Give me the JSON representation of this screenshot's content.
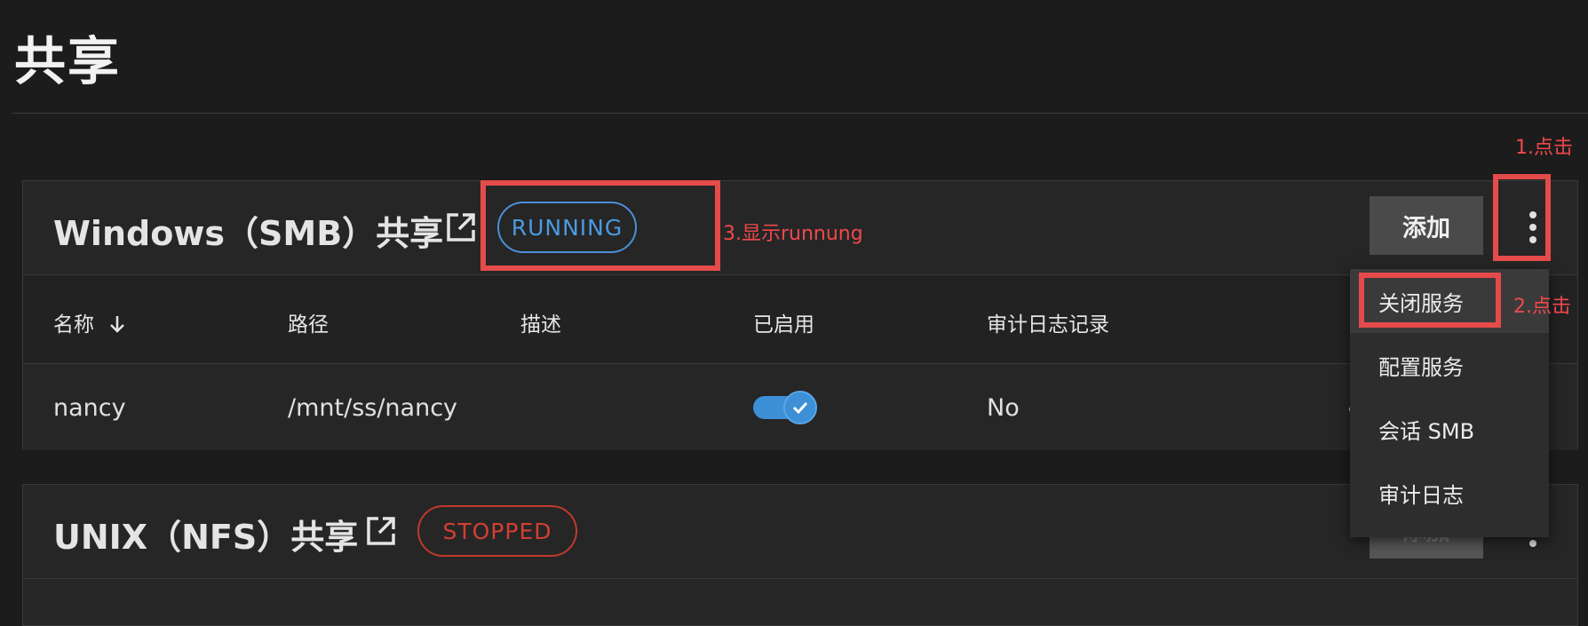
{
  "page": {
    "title": "共享"
  },
  "smb": {
    "title": "Windows（SMB）共享",
    "status": "RUNNING",
    "add_label": "添加",
    "columns": [
      "名称",
      "路径",
      "描述",
      "已启用",
      "审计日志记录"
    ],
    "rows": [
      {
        "name": "nancy",
        "path": "/mnt/ss/nancy",
        "description": "",
        "enabled": true,
        "audit": "No"
      }
    ]
  },
  "nfs": {
    "title": "UNIX（NFS）共享",
    "status": "STOPPED",
    "add_label": "添加"
  },
  "menu": {
    "items": [
      "关闭服务",
      "配置服务",
      "会话 SMB",
      "审计日志"
    ]
  },
  "annotations": {
    "step1": "1.点击",
    "step2": "2.点击",
    "step3": "3.显示runnung"
  },
  "colors": {
    "running": "#4a9ae0",
    "stopped": "#d33f32",
    "annotation": "#e54b4b",
    "toggle_on": "#3d8fd6"
  }
}
